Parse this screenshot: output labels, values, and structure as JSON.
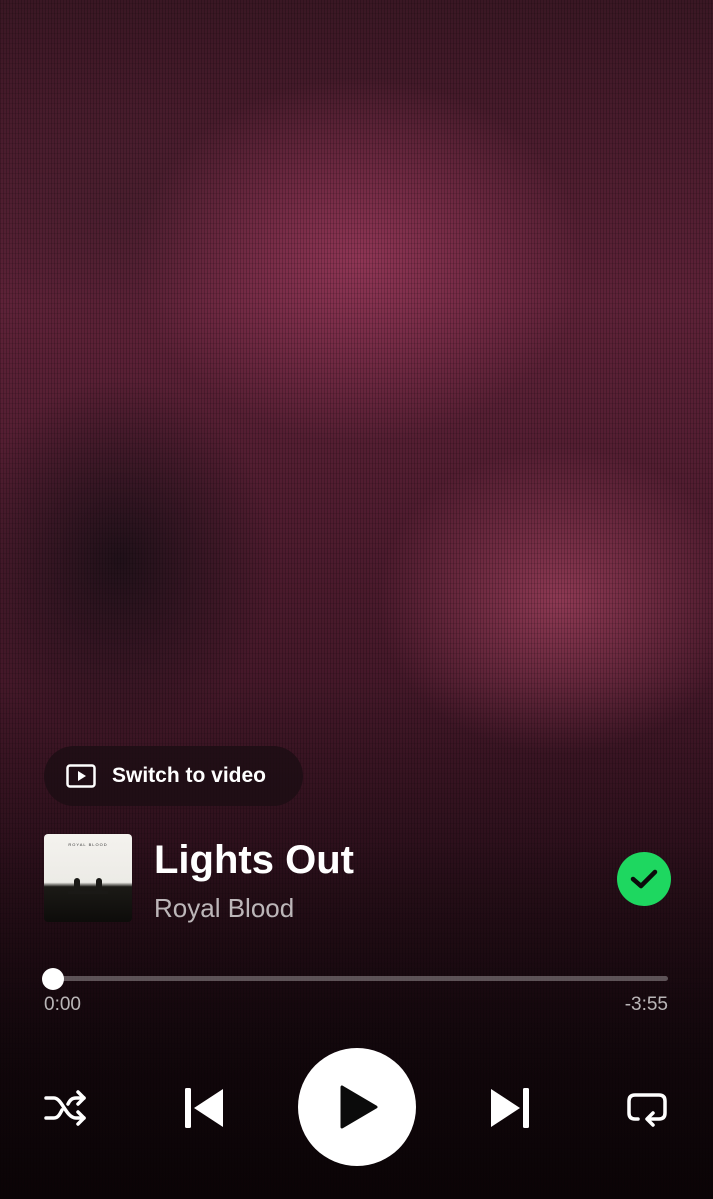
{
  "player": {
    "switch_video_label": "Switch to video",
    "track": {
      "title": "Lights Out",
      "artist": "Royal Blood",
      "album_art_text": "ROYAL BLOOD",
      "liked": true
    },
    "progress": {
      "elapsed": "0:00",
      "remaining": "-3:55",
      "fraction": 0.0
    },
    "controls": {
      "shuffle_icon": "shuffle-icon",
      "previous_icon": "skip-previous-icon",
      "play_icon": "play-icon",
      "next_icon": "skip-next-icon",
      "repeat_icon": "repeat-icon"
    },
    "colors": {
      "accent": "#1ed760",
      "background": "#4a1a2c"
    }
  }
}
